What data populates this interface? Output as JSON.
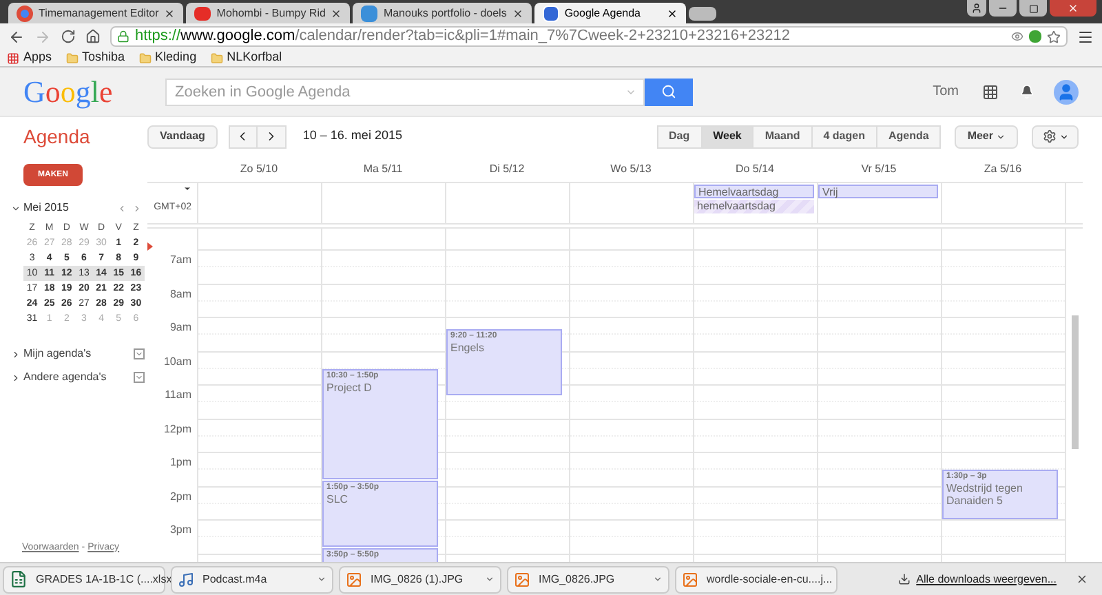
{
  "browser": {
    "tabs": [
      {
        "title": "Timemanagement Editor",
        "kind": "chrome",
        "selected": false
      },
      {
        "title": "Mohombi - Bumpy Rid",
        "kind": "video",
        "selected": false
      },
      {
        "title": "Manouks portfolio - doels",
        "kind": "site",
        "selected": false
      },
      {
        "title": "Google Agenda",
        "kind": "calendar",
        "selected": true
      }
    ],
    "address": {
      "scheme": "https://",
      "host": "www.google.com",
      "path": "/calendar/render?tab=ic&pli=1#main_7%7Cweek-2+23210+23216+23212"
    },
    "bookmarks": [
      {
        "label": "Apps",
        "kind": "apps"
      },
      {
        "label": "Toshiba",
        "kind": "folder"
      },
      {
        "label": "Kleding",
        "kind": "folder"
      },
      {
        "label": "NLKorfbal",
        "kind": "folder"
      }
    ]
  },
  "header": {
    "logo": "Google",
    "search": {
      "placeholder": "Zoeken in Google Agenda"
    },
    "user": "Tom"
  },
  "toolbar": {
    "title": "Agenda",
    "today": "Vandaag",
    "range": "10 – 16. mei 2015",
    "views": [
      {
        "label": "Dag",
        "selected": false
      },
      {
        "label": "Week",
        "selected": true
      },
      {
        "label": "Maand",
        "selected": false
      },
      {
        "label": "4 dagen",
        "selected": false
      },
      {
        "label": "Agenda",
        "selected": false
      }
    ],
    "more": "Meer"
  },
  "sidebar": {
    "create": "MAKEN",
    "month": "Mei 2015",
    "weekdays": [
      "Z",
      "M",
      "D",
      "W",
      "D",
      "V",
      "Z"
    ],
    "weeks": [
      {
        "selected": false,
        "days": [
          {
            "label": "26",
            "muted": true,
            "busy": false
          },
          {
            "label": "27",
            "muted": true,
            "busy": false
          },
          {
            "label": "28",
            "muted": true,
            "busy": false
          },
          {
            "label": "29",
            "muted": true,
            "busy": false
          },
          {
            "label": "30",
            "muted": true,
            "busy": false
          },
          {
            "label": "1",
            "muted": false,
            "busy": true
          },
          {
            "label": "2",
            "muted": false,
            "busy": true
          }
        ]
      },
      {
        "selected": false,
        "days": [
          {
            "label": "3",
            "muted": false,
            "busy": false
          },
          {
            "label": "4",
            "muted": false,
            "busy": true
          },
          {
            "label": "5",
            "muted": false,
            "busy": true
          },
          {
            "label": "6",
            "muted": false,
            "busy": true
          },
          {
            "label": "7",
            "muted": false,
            "busy": true
          },
          {
            "label": "8",
            "muted": false,
            "busy": true
          },
          {
            "label": "9",
            "muted": false,
            "busy": true
          }
        ]
      },
      {
        "selected": true,
        "days": [
          {
            "label": "10",
            "muted": false,
            "busy": false
          },
          {
            "label": "11",
            "muted": false,
            "busy": true
          },
          {
            "label": "12",
            "muted": false,
            "busy": true
          },
          {
            "label": "13",
            "muted": false,
            "busy": false
          },
          {
            "label": "14",
            "muted": false,
            "busy": true
          },
          {
            "label": "15",
            "muted": false,
            "busy": true
          },
          {
            "label": "16",
            "muted": false,
            "busy": true
          }
        ]
      },
      {
        "selected": false,
        "days": [
          {
            "label": "17",
            "muted": false,
            "busy": false
          },
          {
            "label": "18",
            "muted": false,
            "busy": true
          },
          {
            "label": "19",
            "muted": false,
            "busy": true
          },
          {
            "label": "20",
            "muted": false,
            "busy": true
          },
          {
            "label": "21",
            "muted": false,
            "busy": true
          },
          {
            "label": "22",
            "muted": false,
            "busy": true
          },
          {
            "label": "23",
            "muted": false,
            "busy": true
          }
        ]
      },
      {
        "selected": false,
        "days": [
          {
            "label": "24",
            "muted": false,
            "busy": true
          },
          {
            "label": "25",
            "muted": false,
            "busy": true
          },
          {
            "label": "26",
            "muted": false,
            "busy": true
          },
          {
            "label": "27",
            "muted": false,
            "busy": false
          },
          {
            "label": "28",
            "muted": false,
            "busy": true
          },
          {
            "label": "29",
            "muted": false,
            "busy": true
          },
          {
            "label": "30",
            "muted": false,
            "busy": true
          }
        ]
      },
      {
        "selected": false,
        "days": [
          {
            "label": "31",
            "muted": false,
            "busy": false
          },
          {
            "label": "1",
            "muted": true,
            "busy": false
          },
          {
            "label": "2",
            "muted": true,
            "busy": false
          },
          {
            "label": "3",
            "muted": true,
            "busy": false
          },
          {
            "label": "4",
            "muted": true,
            "busy": false
          },
          {
            "label": "5",
            "muted": true,
            "busy": false
          },
          {
            "label": "6",
            "muted": true,
            "busy": false
          }
        ]
      }
    ],
    "calendars": [
      {
        "label": "Mijn agenda's",
        "expanded": false
      },
      {
        "label": "Andere agenda's",
        "expanded": false
      }
    ],
    "footer": {
      "terms": "Voorwaarden",
      "separator": "-",
      "privacy": "Privacy"
    }
  },
  "calendar": {
    "timezone": "GMT+02",
    "hours": [
      "7am",
      "8am",
      "9am",
      "10am",
      "11am",
      "12pm",
      "1pm",
      "2pm",
      "3pm"
    ],
    "days": [
      {
        "label": "Zo 5/10"
      },
      {
        "label": "Ma 5/11",
        "events": [
          {
            "time": "10:30 – 1:50p",
            "title": "Project D"
          },
          {
            "time": "1:50p – 3:50p",
            "title": "SLC"
          },
          {
            "time": "3:50p – 5:50p"
          }
        ]
      },
      {
        "label": "Di 5/12",
        "events": [
          {
            "time": "9:20 – 11:20",
            "title": "Engels"
          }
        ]
      },
      {
        "label": "Wo 5/13"
      },
      {
        "label": "Do 5/14",
        "all_day": [
          {
            "title": "Hemelvaartsdag",
            "kind": "solid"
          },
          {
            "title": "hemelvaartsdag",
            "kind": "striped"
          }
        ]
      },
      {
        "label": "Vr 5/15",
        "all_day": [
          {
            "title": "Vrij",
            "kind": "solid"
          }
        ]
      },
      {
        "label": "Za 5/16",
        "events": [
          {
            "time": "1:30p – 3p",
            "title": "Wedstrijd tegen Danaiden 5"
          }
        ]
      }
    ]
  },
  "downloads": {
    "items": [
      {
        "name": "GRADES 1A-1B-1C (....xlsx",
        "kind": "spreadsheet"
      },
      {
        "name": "Podcast.m4a",
        "kind": "audio"
      },
      {
        "name": "IMG_0826 (1).JPG",
        "kind": "image"
      },
      {
        "name": "IMG_0826.JPG",
        "kind": "image"
      },
      {
        "name": "wordle-sociale-en-cu....j...",
        "kind": "image"
      }
    ],
    "show_all": "Alle downloads weergeven..."
  }
}
